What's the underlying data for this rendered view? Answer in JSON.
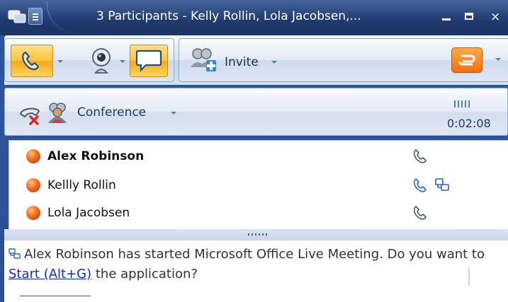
{
  "window": {
    "title": "3 Participants - Kelly Rollin, Lola Jacobsen,...",
    "controls": {
      "minimize_icon": "minimize-icon",
      "maximize_icon": "maximize-icon",
      "close": "×"
    }
  },
  "toolbar": {
    "invite_label": "Invite"
  },
  "conference_bar": {
    "conference_label": "Conference",
    "timer": "0:02:08"
  },
  "participants": [
    {
      "name": "Alex Robinson",
      "bold": true,
      "icons": [
        "phone-icon"
      ]
    },
    {
      "name": "Kellly Rollin",
      "bold": false,
      "icons": [
        "phone-icon",
        "desktop-share-icon"
      ]
    },
    {
      "name": "Lola Jacobsen",
      "bold": false,
      "icons": [
        "phone-icon"
      ]
    }
  ],
  "message": {
    "part1": "Alex Robinson has started Microsoft Office Live Meeting. Do you want to ",
    "link": "Start (Alt+G)",
    "part2": " the application?"
  },
  "colors": {
    "accent_orange": "#f46f0c",
    "active_button": "#ffc23a",
    "title_bar": "#1e3a6e",
    "link": "#0b2bd8"
  }
}
